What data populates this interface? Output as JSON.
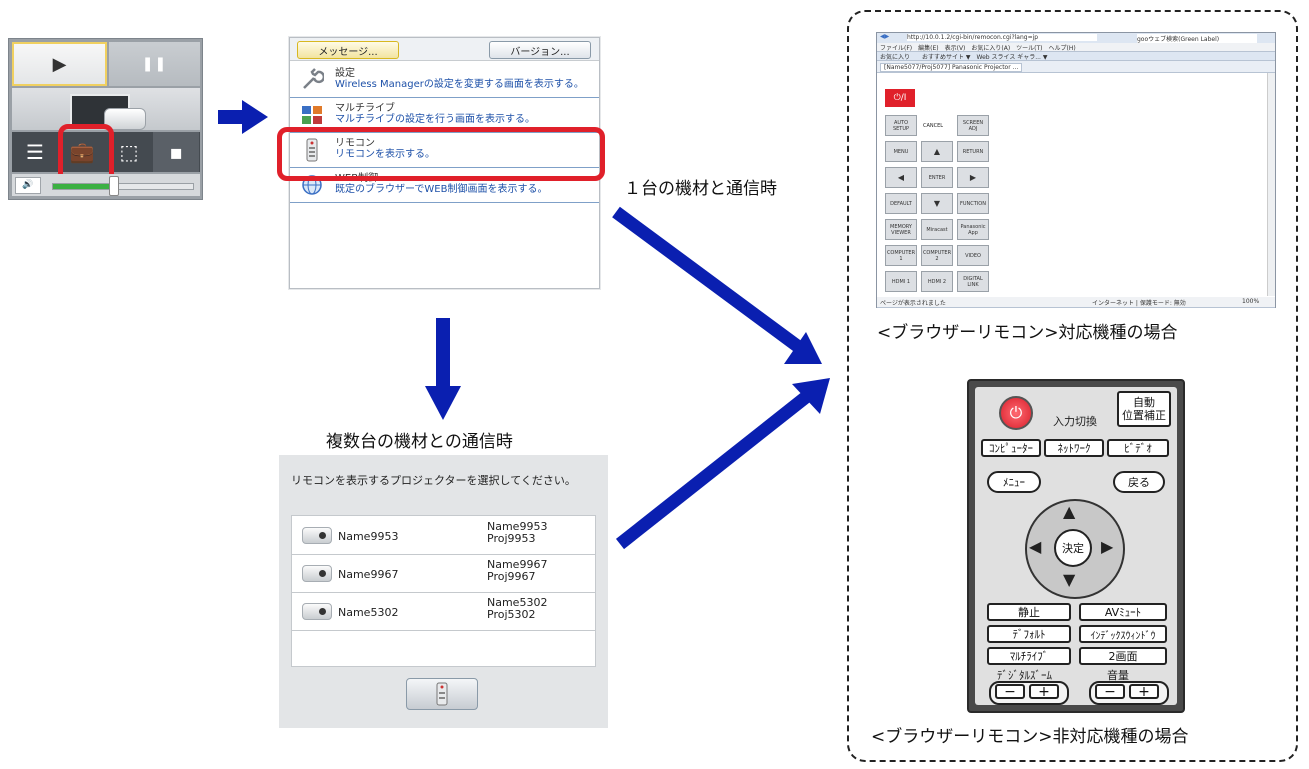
{
  "launcher": {
    "play_icon": "▶",
    "pause_icon": "❚❚"
  },
  "menu": {
    "message_btn": "メッセージ...",
    "version_btn": "バージョン...",
    "items": [
      {
        "title": "設定",
        "desc": "Wireless Managerの設定を変更する画面を表示する。",
        "icon": "wrench-icon"
      },
      {
        "title": "マルチライブ",
        "desc": "マルチライブの設定を行う画面を表示する。",
        "icon": "multilive-icon"
      },
      {
        "title": "リモコン",
        "desc": "リモコンを表示する。",
        "icon": "remote-icon"
      },
      {
        "title": "WEB制御",
        "desc": "既定のブラウザーでWEB制御画面を表示する。",
        "icon": "globe-icon"
      }
    ]
  },
  "labels": {
    "single": "１台の機材と通信時",
    "multiple": "複数台の機材との通信時",
    "browser_supported": "<ブラウザーリモコン>対応機種の場合",
    "browser_unsupported": "<ブラウザーリモコン>非対応機種の場合"
  },
  "select": {
    "prompt": "リモコンを表示するプロジェクターを選択してください。",
    "rows": [
      {
        "name": "Name9953",
        "line1": "Name9953",
        "line2": "Proj9953"
      },
      {
        "name": "Name9967",
        "line1": "Name9967",
        "line2": "Proj9967"
      },
      {
        "name": "Name5302",
        "line1": "Name5302",
        "line2": "Proj5302"
      }
    ]
  },
  "browser": {
    "url": "http://10.0.1.2/cgi-bin/remocon.cgi?lang=jp",
    "search": "gooウェブ検索(Green Label)",
    "menubar": "ファイル(F)　編集(E)　表示(V)　お気に入り(A)　ツール(T)　ヘルプ(H)",
    "favorites": "お気に入り　　おすすめサイト ▼　Web スライス ギャラ... ▼",
    "tab": "[Name5077/Proj5077] Panasonic Projector ...",
    "power": "⏻/I",
    "status_left": "ページが表示されました",
    "status_mid": "インターネット | 保護モード: 無効",
    "zoom": "100%",
    "buttons": {
      "auto_setup": "AUTO SETUP",
      "cancel": "CANCEL",
      "screen_adj": "SCREEN ADJ",
      "menu": "MENU",
      "up": "▲",
      "return": "RETURN",
      "left": "◀",
      "enter": "ENTER",
      "right": "▶",
      "default": "DEFAULT",
      "down": "▼",
      "function": "FUNCTION",
      "memory_viewer": "MEMORY VIEWER",
      "miracast": "Miracast",
      "panasonic_app": "Panasonic App",
      "computer1": "COMPUTER 1",
      "computer2": "COMPUTER 2",
      "video": "VIDEO",
      "hdmi1": "HDMI 1",
      "hdmi2": "HDMI 2",
      "digital_link": "DIGITAL LINK"
    }
  },
  "remote": {
    "input_label": "入力切換",
    "auto": "自動\n位置補正",
    "computer": "ｺﾝﾋﾟｭｰﾀｰ",
    "network": "ﾈｯﾄﾜｰｸ",
    "video": "ﾋﾞﾃﾞｵ",
    "menu": "ﾒﾆｭｰ",
    "back": "戻る",
    "enter": "決定",
    "freeze": "静止",
    "av_mute": "AVﾐｭｰﾄ",
    "default": "ﾃﾞﾌｫﾙﾄ",
    "index_window": "ｲﾝﾃﾞｯｸｽｳｨﾝﾄﾞｳ",
    "multilive": "ﾏﾙﾁﾗｲﾌﾞ",
    "two_screen": "2画面",
    "digital_zoom": "ﾃﾞｼﾞﾀﾙｽﾞｰﾑ",
    "volume": "音量",
    "minus": "−",
    "plus": "+"
  },
  "colors": {
    "arrow": "#0a1fb0",
    "highlight": "#e0202a",
    "link": "#1d50a8"
  }
}
